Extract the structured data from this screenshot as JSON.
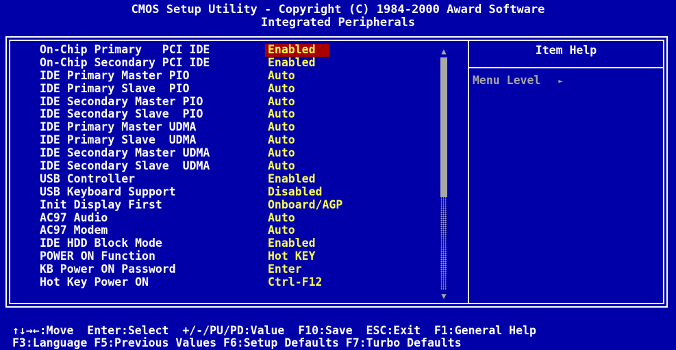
{
  "header": {
    "title_line1": "CMOS Setup Utility - Copyright (C) 1984-2000 Award Software",
    "title_line2": "Integrated Peripherals"
  },
  "settings": [
    {
      "label": "On-Chip Primary   PCI IDE",
      "value": "Enabled",
      "selected": true
    },
    {
      "label": "On-Chip Secondary PCI IDE",
      "value": "Enabled"
    },
    {
      "label": "IDE Primary Master PIO",
      "value": "Auto"
    },
    {
      "label": "IDE Primary Slave  PIO",
      "value": "Auto"
    },
    {
      "label": "IDE Secondary Master PIO",
      "value": "Auto"
    },
    {
      "label": "IDE Secondary Slave  PIO",
      "value": "Auto"
    },
    {
      "label": "IDE Primary Master UDMA",
      "value": "Auto"
    },
    {
      "label": "IDE Primary Slave  UDMA",
      "value": "Auto"
    },
    {
      "label": "IDE Secondary Master UDMA",
      "value": "Auto"
    },
    {
      "label": "IDE Secondary Slave  UDMA",
      "value": "Auto"
    },
    {
      "label": "USB Controller",
      "value": "Enabled"
    },
    {
      "label": "USB Keyboard Support",
      "value": "Disabled"
    },
    {
      "label": "Init Display First",
      "value": "Onboard/AGP"
    },
    {
      "label": "AC97 Audio",
      "value": "Auto"
    },
    {
      "label": "AC97 Modem",
      "value": "Auto"
    },
    {
      "label": "IDE HDD Block Mode",
      "value": "Enabled"
    },
    {
      "label": "POWER ON Function",
      "value": "Hot KEY"
    },
    {
      "label": "KB Power ON Password",
      "value": "Enter"
    },
    {
      "label": "Hot Key Power ON",
      "value": "Ctrl-F12"
    }
  ],
  "help": {
    "title": "Item Help",
    "menu_level_label": "Menu Level"
  },
  "footer": {
    "line1": "↑↓→←:Move  Enter:Select  +/-/PU/PD:Value  F10:Save  ESC:Exit  F1:General Help",
    "line2": "F3:Language F5:Previous Values F6:Setup Defaults F7:Turbo Defaults"
  },
  "icons": {
    "scroll_up": "scroll-up-arrow-icon",
    "scroll_down": "scroll-down-arrow-icon",
    "submenu": "submenu-arrow-icon"
  },
  "colors": {
    "background": "#0000a8",
    "text": "#ffffff",
    "value": "#ffff54",
    "highlight": "#a80000",
    "dim": "#a8a8a8"
  }
}
